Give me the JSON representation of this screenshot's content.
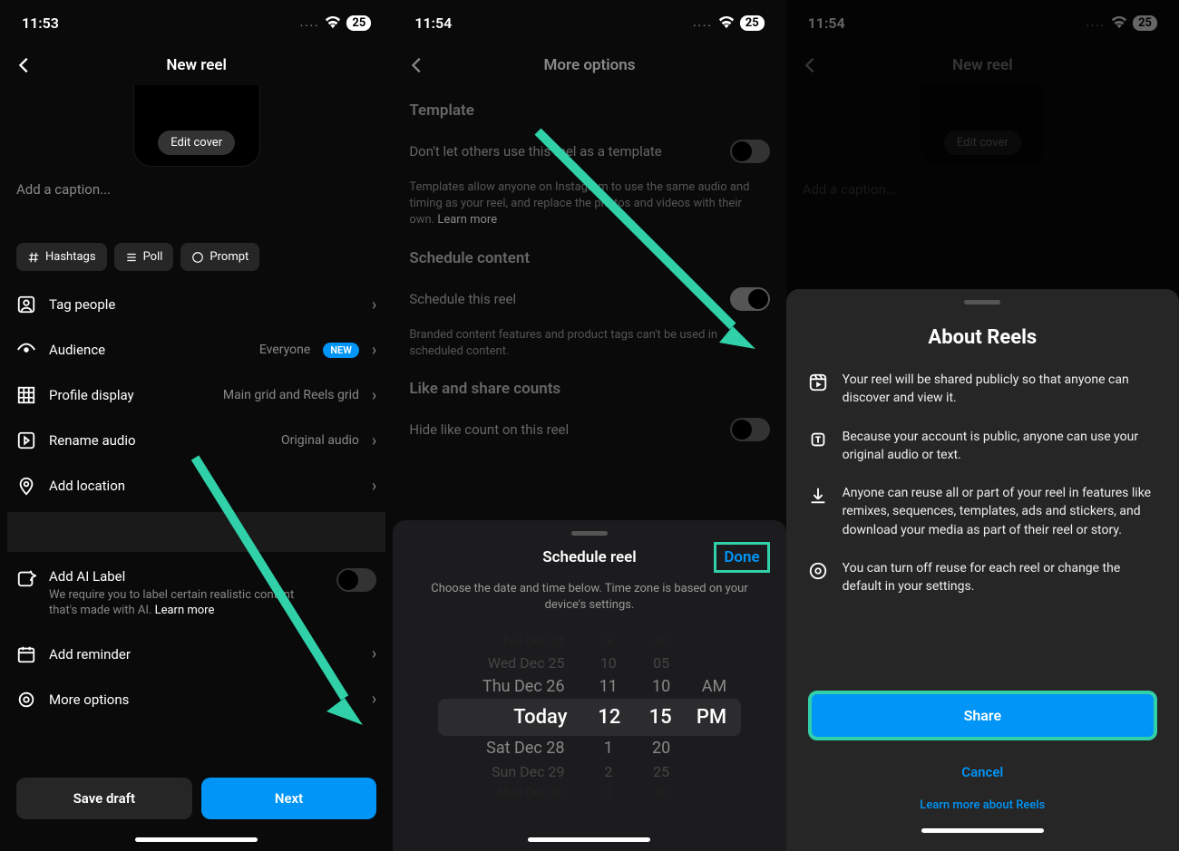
{
  "status": {
    "time1": "11:53",
    "time2": "11:54",
    "time3": "11:54",
    "dots": "....",
    "battery": "25"
  },
  "s1": {
    "title": "New reel",
    "edit_cover": "Edit cover",
    "caption_placeholder": "Add a caption...",
    "chips": {
      "hashtags": "Hashtags",
      "poll": "Poll",
      "prompt": "Prompt"
    },
    "rows": {
      "tag": "Tag people",
      "audience": "Audience",
      "audience_val": "Everyone",
      "new": "NEW",
      "profile": "Profile display",
      "profile_val": "Main grid and Reels grid",
      "rename": "Rename audio",
      "rename_val": "Original audio",
      "location": "Add location",
      "ai": "Add AI Label",
      "ai_sub": "We require you to label certain realistic content that's made with AI. ",
      "ai_learn": "Learn more",
      "reminder": "Add reminder",
      "more": "More options"
    },
    "save_draft": "Save draft",
    "next": "Next"
  },
  "s2": {
    "title": "More options",
    "template_h": "Template",
    "template_row": "Don't let others use this reel as a template",
    "template_desc": "Templates allow anyone on Instagram to use the same audio and timing as your reel, and replace the photos and videos with their own. ",
    "template_learn": "Learn more",
    "schedule_h": "Schedule content",
    "schedule_row": "Schedule this reel",
    "schedule_desc": "Branded content features and product tags can't be used in scheduled content.",
    "likes_h": "Like and share counts",
    "likes_row": "Hide like count on this reel",
    "sheet": {
      "title": "Schedule reel",
      "done": "Done",
      "desc": "Choose the date and time below. Time zone is based on your device's settings.",
      "rows": [
        {
          "d": "Tue Dec 24",
          "h": "9",
          "m": "00",
          "ap": ""
        },
        {
          "d": "Wed Dec 25",
          "h": "10",
          "m": "05",
          "ap": ""
        },
        {
          "d": "Thu Dec 26",
          "h": "11",
          "m": "10",
          "ap": "AM"
        },
        {
          "d": "Today",
          "h": "12",
          "m": "15",
          "ap": "PM"
        },
        {
          "d": "Sat Dec 28",
          "h": "1",
          "m": "20",
          "ap": ""
        },
        {
          "d": "Sun Dec 29",
          "h": "2",
          "m": "25",
          "ap": ""
        },
        {
          "d": "Mon Dec 30",
          "h": "3",
          "m": "30",
          "ap": ""
        }
      ]
    }
  },
  "s3": {
    "title": "New reel",
    "edit_cover": "Edit cover",
    "caption_placeholder": "Add a caption...",
    "about": {
      "title": "About Reels",
      "p1": "Your reel will be shared publicly so that anyone can discover and view it.",
      "p2": "Because your account is public, anyone can use your original audio or text.",
      "p3": "Anyone can reuse all or part of your reel in features like remixes, sequences, templates, ads and stickers, and download your media as part of their reel or story.",
      "p4": "You can turn off reuse for each reel or change the default in your settings.",
      "share": "Share",
      "cancel": "Cancel",
      "learn": "Learn more about Reels"
    }
  }
}
